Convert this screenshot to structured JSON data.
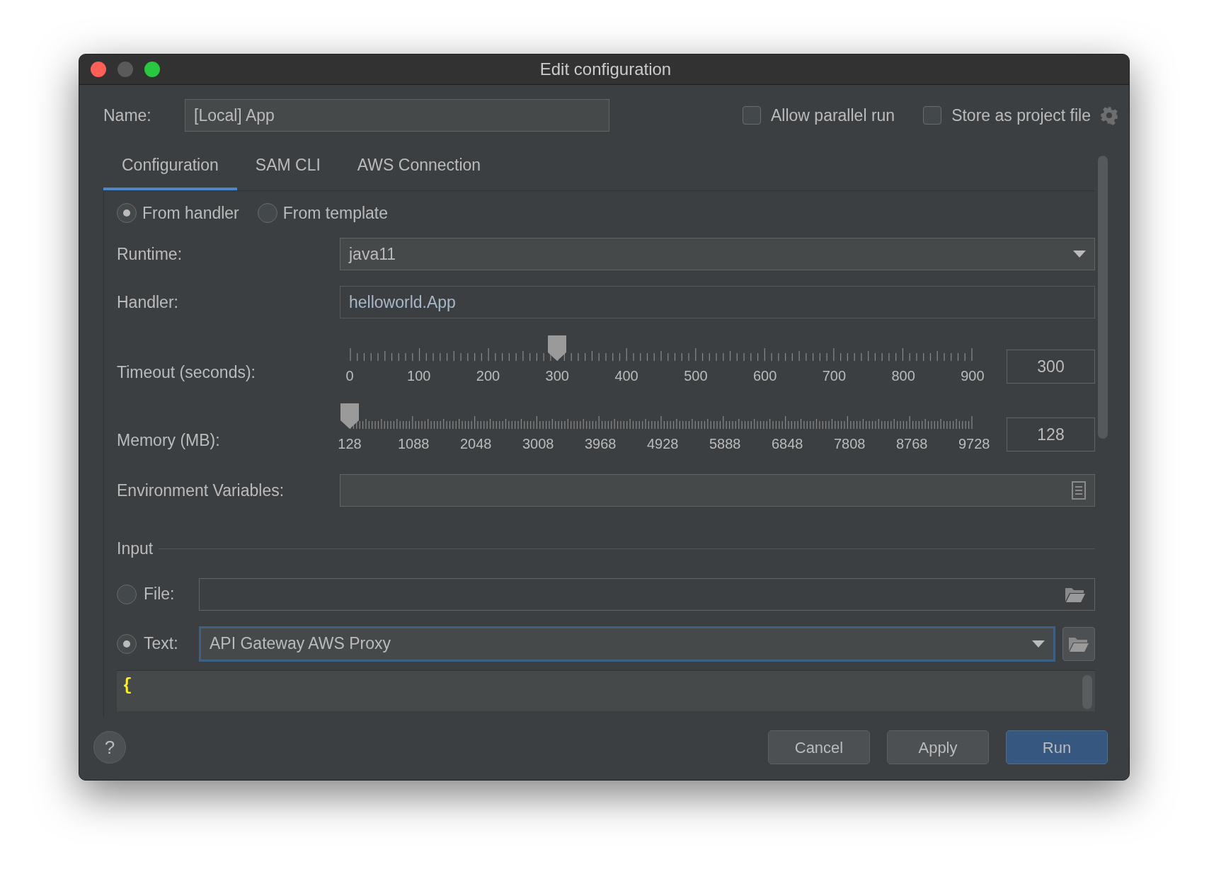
{
  "window": {
    "title": "Edit configuration"
  },
  "name_field": {
    "label": "Name:",
    "value": "[Local] App"
  },
  "options": [
    {
      "label": "Allow parallel run",
      "checked": false
    },
    {
      "label": "Store as project file",
      "checked": false
    }
  ],
  "tabs": [
    {
      "label": "Configuration",
      "selected": true
    },
    {
      "label": "SAM CLI",
      "selected": false
    },
    {
      "label": "AWS Connection",
      "selected": false
    }
  ],
  "source": [
    {
      "label": "From handler",
      "selected": true
    },
    {
      "label": "From template",
      "selected": false
    }
  ],
  "fields": [
    {
      "kind": "dropdown",
      "label": "Runtime:",
      "value": "java11"
    },
    {
      "kind": "text",
      "label": "Handler:",
      "value": "helloworld.App"
    },
    {
      "kind": "slider",
      "label": "Timeout (seconds):",
      "level": 0.333,
      "ticks": [
        "0",
        "100",
        "200",
        "300",
        "400",
        "500",
        "600",
        "700",
        "800",
        "900"
      ],
      "value": "300"
    },
    {
      "kind": "slider",
      "label": "Memory (MB):",
      "level": 0,
      "ticks": [
        "128",
        "1088",
        "2048",
        "3008",
        "3968",
        "4928",
        "5888",
        "6848",
        "7808",
        "8768",
        "9728"
      ],
      "value": "128"
    },
    {
      "kind": "env",
      "label": "Environment Variables:"
    }
  ],
  "input": {
    "title": "Input",
    "choices": [
      {
        "kind": "file",
        "label": "File:",
        "selected": false
      },
      {
        "kind": "text",
        "label": "Text:",
        "selected": true,
        "value": "API Gateway AWS Proxy"
      }
    ],
    "editor_lines": [
      "{"
    ]
  },
  "help": {
    "label": "?"
  },
  "buttons": [
    {
      "label": "Cancel",
      "kind": "default"
    },
    {
      "label": "Apply",
      "kind": "default"
    },
    {
      "label": "Run",
      "kind": "primary"
    }
  ]
}
